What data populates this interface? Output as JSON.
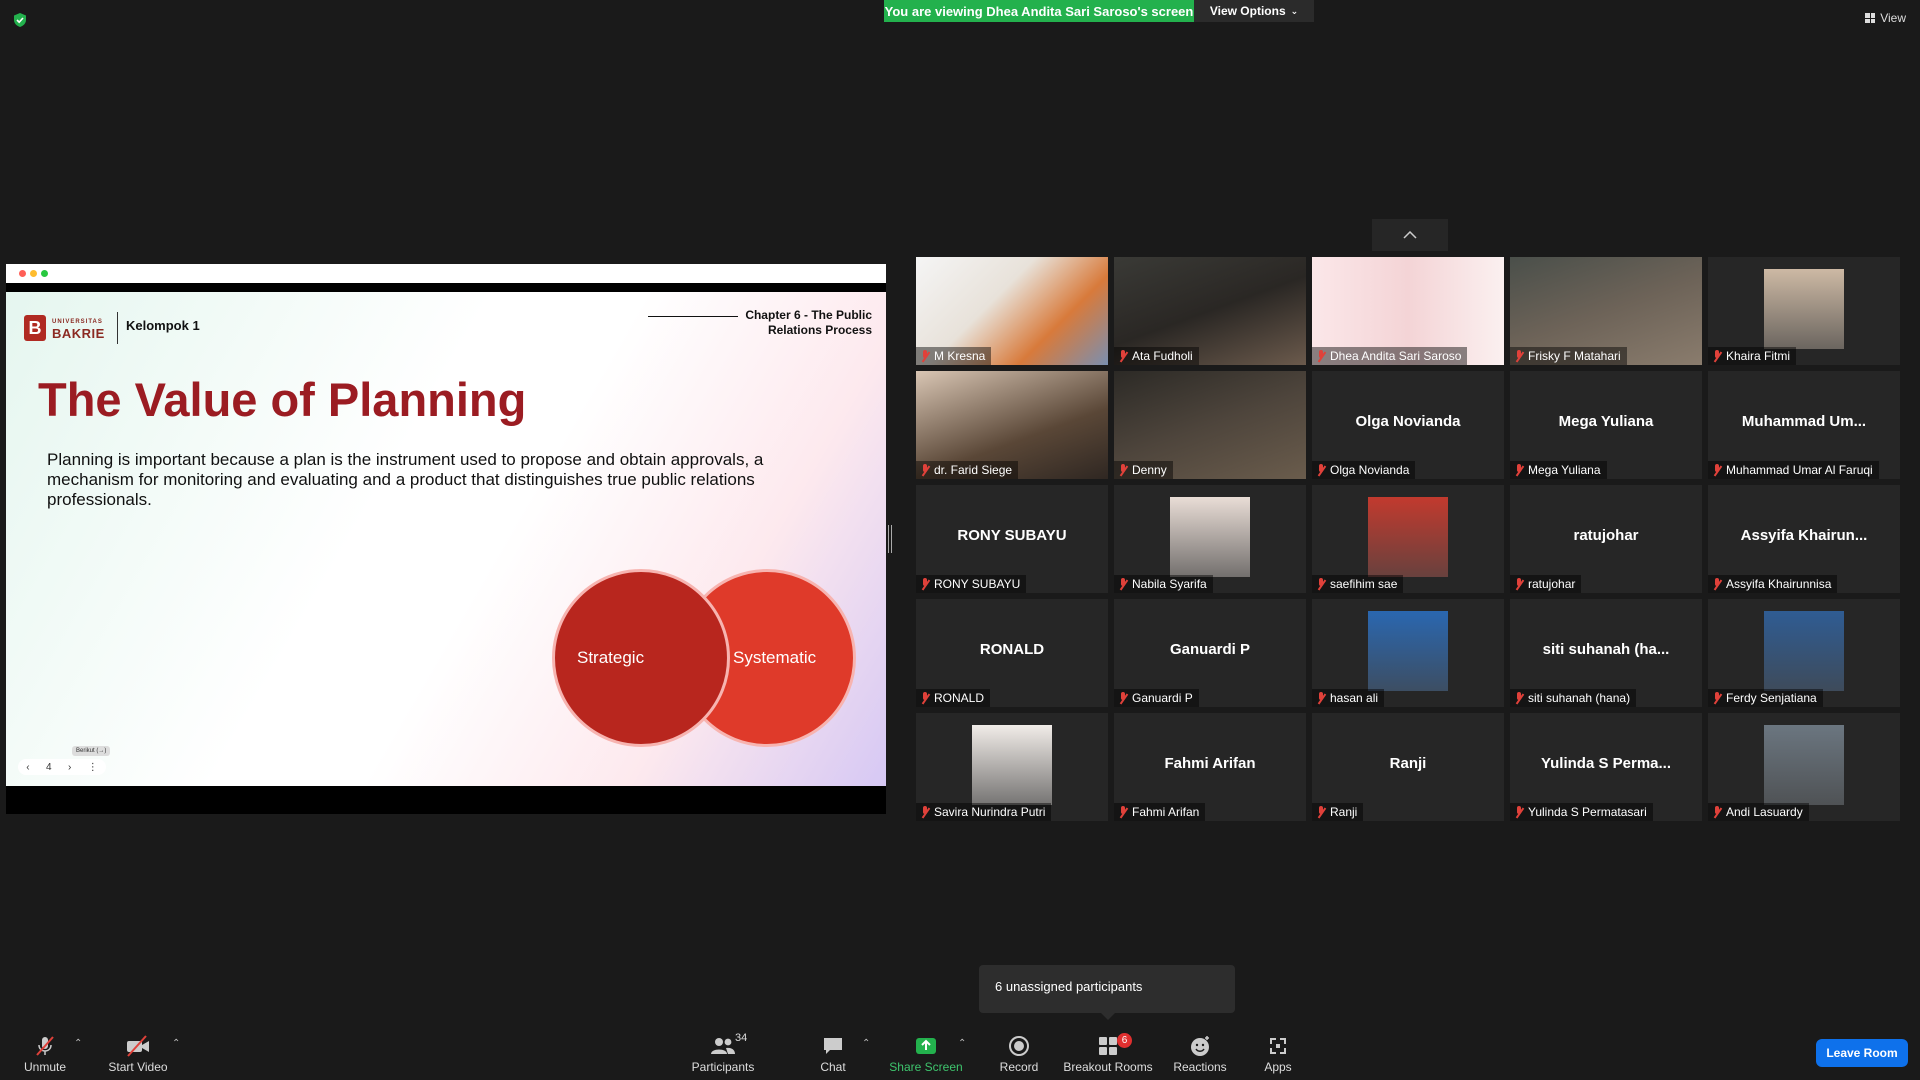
{
  "top": {
    "sharing_banner": "You are viewing Dhea Andita Sari Saroso's screen",
    "view_options": "View Options",
    "view": "View"
  },
  "slide": {
    "university_small": "UNIVERSITAS",
    "university": "BAKRIE",
    "group": "Kelompok 1",
    "chapter": "Chapter 6 - The Public Relations Process",
    "title": "The Value of Planning",
    "body": "Planning is important because a plan is the instrument used to propose and obtain approvals, a mechanism for monitoring and evaluating and a product that distinguishes true public relations professionals.",
    "circle_left": "Strategic",
    "circle_right": "Systematic",
    "page_number": "4",
    "next_tooltip": "Berikut (→)"
  },
  "participants": [
    {
      "name": "M Kresna",
      "center": ""
    },
    {
      "name": "Ata Fudholi",
      "center": ""
    },
    {
      "name": "Dhea Andita Sari Saroso",
      "center": ""
    },
    {
      "name": "Frisky F Matahari",
      "center": ""
    },
    {
      "name": "Khaira Fitmi",
      "center": ""
    },
    {
      "name": "dr. Farid Siege",
      "center": ""
    },
    {
      "name": "Denny",
      "center": ""
    },
    {
      "name": "Olga Novianda",
      "center": "Olga Novianda"
    },
    {
      "name": "Mega Yuliana",
      "center": "Mega Yuliana"
    },
    {
      "name": "Muhammad Umar Al Faruqi",
      "center": "Muhammad Um..."
    },
    {
      "name": "RONY SUBAYU",
      "center": "RONY SUBAYU"
    },
    {
      "name": "Nabila Syarifa",
      "center": ""
    },
    {
      "name": "saefihim sae",
      "center": ""
    },
    {
      "name": "ratujohar",
      "center": "ratujohar"
    },
    {
      "name": "Assyifa Khairunnisa",
      "center": "Assyifa Khairun..."
    },
    {
      "name": "RONALD",
      "center": "RONALD"
    },
    {
      "name": "Ganuardi P",
      "center": "Ganuardi P"
    },
    {
      "name": "hasan ali",
      "center": ""
    },
    {
      "name": "siti suhanah (hana)",
      "center": "siti suhanah (ha..."
    },
    {
      "name": "Ferdy Senjatiana",
      "center": ""
    },
    {
      "name": "Savira Nurindra Putri",
      "center": ""
    },
    {
      "name": "Fahmi Arifan",
      "center": "Fahmi Arifan"
    },
    {
      "name": "Ranji",
      "center": "Ranji"
    },
    {
      "name": "Yulinda S Permatasari",
      "center": "Yulinda S Perma..."
    },
    {
      "name": "Andi Lasuardy",
      "center": ""
    }
  ],
  "tooltip": "6 unassigned participants",
  "toolbar": {
    "unmute": "Unmute",
    "start_video": "Start Video",
    "participants": "Participants",
    "participants_count": "34",
    "chat": "Chat",
    "share_screen": "Share Screen",
    "record": "Record",
    "breakout_rooms": "Breakout Rooms",
    "breakout_badge": "6",
    "reactions": "Reactions",
    "apps": "Apps",
    "leave": "Leave Room"
  }
}
